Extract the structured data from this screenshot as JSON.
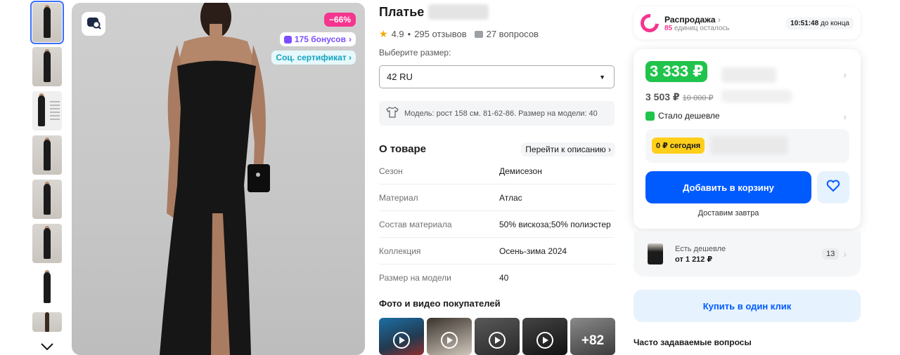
{
  "gallery": {
    "thumbnails": [
      "thumb-1",
      "thumb-2",
      "thumb-3",
      "thumb-4",
      "thumb-5",
      "thumb-6",
      "thumb-7",
      "thumb-8"
    ],
    "scroll_icon": "chevron-down-icon",
    "zoom_icon": "image-search-icon",
    "discount_badge": "−66%",
    "bonus_badge": "175 бонусов",
    "certificate_badge": "Соц. сертификат"
  },
  "product": {
    "title": "Платье",
    "rating": "4.9",
    "separator": "•",
    "reviews": "295 отзывов",
    "questions": "27 вопросов",
    "size_label": "Выберите размер:",
    "size_value": "42 RU",
    "model_info": "Модель: рост 158 см. 81-62-86. Размер на модели: 40",
    "about_title": "О товаре",
    "go_to_description": "Перейти к описанию",
    "specs": [
      {
        "key": "Сезон",
        "value": "Демисезон"
      },
      {
        "key": "Материал",
        "value": "Атлас"
      },
      {
        "key": "Состав материала",
        "value": "50% вискоза;50% полиэстер"
      },
      {
        "key": "Коллекция",
        "value": "Осень-зима 2024"
      },
      {
        "key": "Размер на модели",
        "value": "40"
      }
    ],
    "customer_media_title": "Фото и видео покупателей",
    "customer_media_more": "+82"
  },
  "sale": {
    "title": "Распродажа",
    "remaining_count": "85",
    "remaining_text": "единиц осталось",
    "timer": "10:51:48",
    "timer_suffix": "до конца"
  },
  "buybox": {
    "price": "3 333 ₽",
    "price_secondary": "3 503 ₽",
    "price_old": "10 000 ₽",
    "cheaper_label": "Стало дешевле",
    "split_tag": "0 ₽ сегодня",
    "add_to_cart": "Добавить в корзину",
    "delivery": "Доставим завтра"
  },
  "cheaper_offers": {
    "label": "Есть дешевле",
    "price": "от 1 212 ₽",
    "count": "13"
  },
  "buy_one_click": "Купить в один клик",
  "faq_title": "Часто задаваемые вопросы",
  "colors": {
    "brand_blue": "#005bff",
    "discount_pink": "#f5358e",
    "price_green": "#20c34b",
    "bonus_purple": "#7b4dff",
    "split_yellow": "#ffcf1a"
  }
}
